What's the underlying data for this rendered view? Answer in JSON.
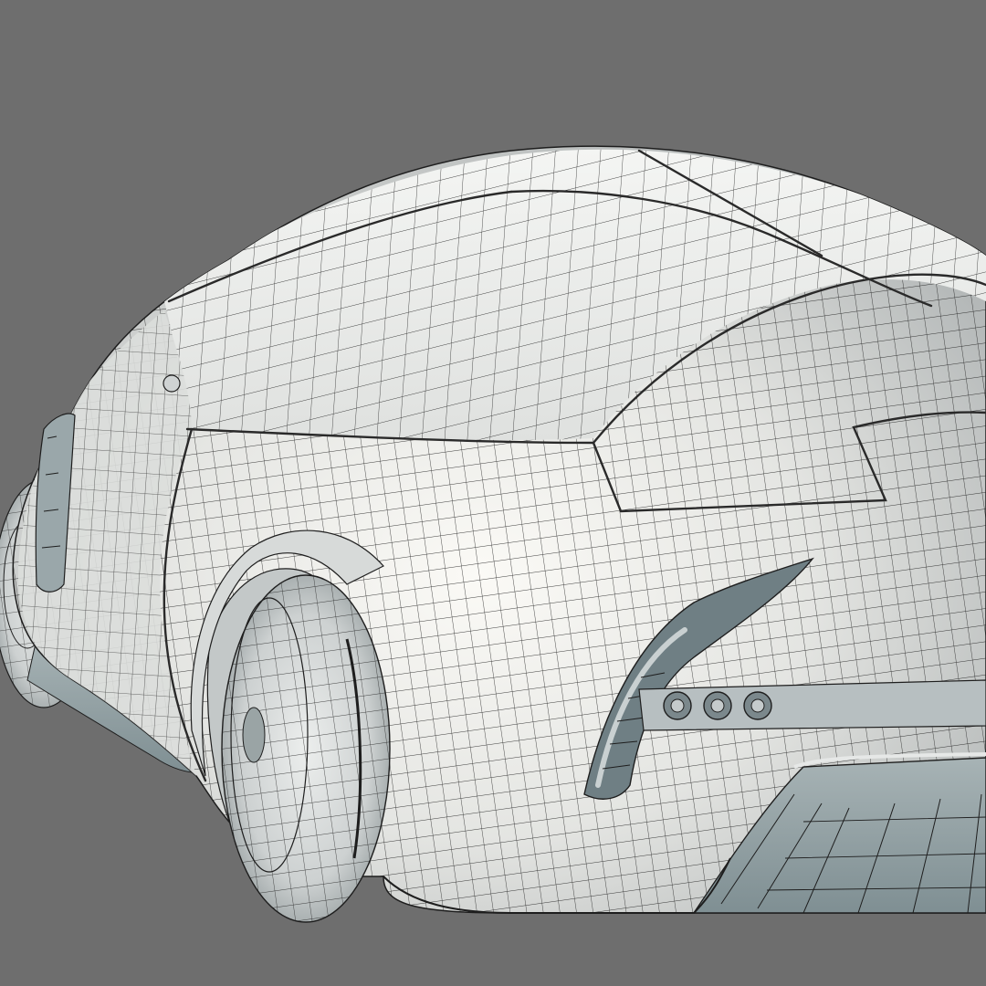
{
  "scene": {
    "subject": "car-wireframe-render",
    "view": "rear-three-quarter",
    "colors": {
      "background": "#6e6e6e",
      "body": "#e6e6e3",
      "body_shadow": "#b9bcbc",
      "wire": "#1e1e1e",
      "tire": "#d2d5d5",
      "underside": "#8f9fa3",
      "light_trim": "#5f6f74"
    },
    "visible_parts": [
      "body-shell",
      "roof-panel",
      "rear-left-wheel",
      "rear-right-wheel",
      "tail-light-cluster",
      "rear-diffuser",
      "side-trim"
    ]
  }
}
